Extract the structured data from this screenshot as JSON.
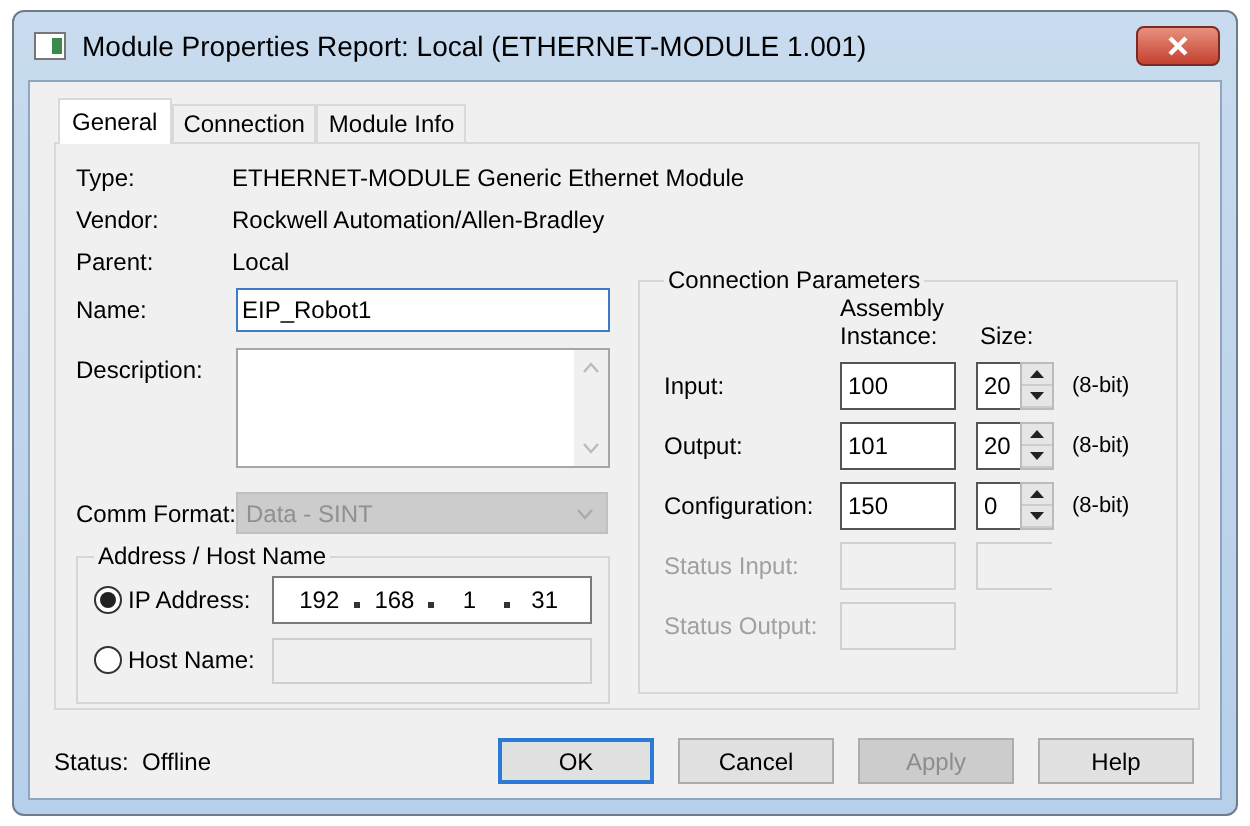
{
  "window": {
    "title": "Module Properties Report: Local (ETHERNET-MODULE 1.001)"
  },
  "tabs": [
    {
      "label": "General",
      "selected": true
    },
    {
      "label": "Connection",
      "selected": false
    },
    {
      "label": "Module Info",
      "selected": false
    }
  ],
  "info": [
    {
      "label": "Type:",
      "value": "ETHERNET-MODULE Generic Ethernet Module"
    },
    {
      "label": "Vendor:",
      "value": "Rockwell Automation/Allen-Bradley"
    },
    {
      "label": "Parent:",
      "value": "Local"
    }
  ],
  "name": {
    "label": "Name:",
    "value": "EIP_Robot1"
  },
  "description": {
    "label": "Description:"
  },
  "comm_format": {
    "label": "Comm Format:",
    "value": "Data - SINT",
    "disabled": true
  },
  "address": {
    "title": "Address / Host Name",
    "options": [
      {
        "kind": "ip",
        "label": "IP Address:",
        "selected": true,
        "octets": [
          "192",
          "168",
          "1",
          "31"
        ]
      },
      {
        "kind": "host",
        "label": "Host Name:",
        "selected": false
      }
    ]
  },
  "connection": {
    "title": "Connection Parameters",
    "headers": [
      "Assembly Instance:",
      "Size:"
    ],
    "rows": [
      {
        "label": "Input:",
        "instance": "100",
        "size": "20",
        "unit": "(8-bit)",
        "disabled": false,
        "kind": "sized"
      },
      {
        "label": "Output:",
        "instance": "101",
        "size": "20",
        "unit": "(8-bit)",
        "disabled": false,
        "kind": "sized"
      },
      {
        "label": "Configuration:",
        "instance": "150",
        "size": "0",
        "unit": "(8-bit)",
        "disabled": false,
        "kind": "sized"
      },
      {
        "label": "Status Input:",
        "disabled": true,
        "kind": "sized"
      },
      {
        "label": "Status Output:",
        "disabled": true,
        "kind": "plain"
      }
    ]
  },
  "status": {
    "label": "Status:",
    "value": "Offline"
  },
  "buttons": [
    {
      "label": "OK",
      "default": true,
      "disabled": false
    },
    {
      "label": "Cancel",
      "default": false,
      "disabled": false
    },
    {
      "label": "Apply",
      "default": false,
      "disabled": true
    },
    {
      "label": "Help",
      "default": false,
      "disabled": false
    }
  ]
}
